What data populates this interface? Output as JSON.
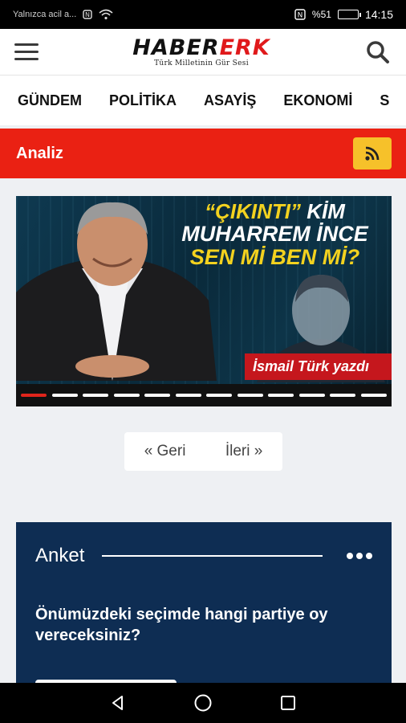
{
  "status_bar": {
    "notification": "Yalnızca acil a...",
    "battery_text": "%51",
    "battery_level": 0.51,
    "time": "14:15"
  },
  "header": {
    "logo_part1": "HABER",
    "logo_part2": "ERK",
    "slogan": "Türk Milletinin Gür Sesi",
    "brand_color": "#e0191b"
  },
  "nav": {
    "items": [
      "GÜNDEM",
      "POLİTİKA",
      "ASAYİŞ",
      "EKONOMİ",
      "S"
    ]
  },
  "section": {
    "title": "Analiz",
    "bar_color": "#ea2113",
    "rss_color": "#f6c12a"
  },
  "slider": {
    "headline_quote": "“ÇIKINTI”",
    "headline_line1_rest": " KİM",
    "headline_line2": "MUHARREM İNCE",
    "headline_line3": "SEN Mİ BEN Mİ?",
    "byline": "İsmail Türk yazdı",
    "slide_count": 12,
    "active_index": 0
  },
  "pager": {
    "prev": "« Geri",
    "next": "İleri »"
  },
  "poll": {
    "title": "Anket",
    "question": "Önümüzdeki seçimde hangi partiye oy vereceksiniz?",
    "bg_color": "#0e2d53"
  }
}
